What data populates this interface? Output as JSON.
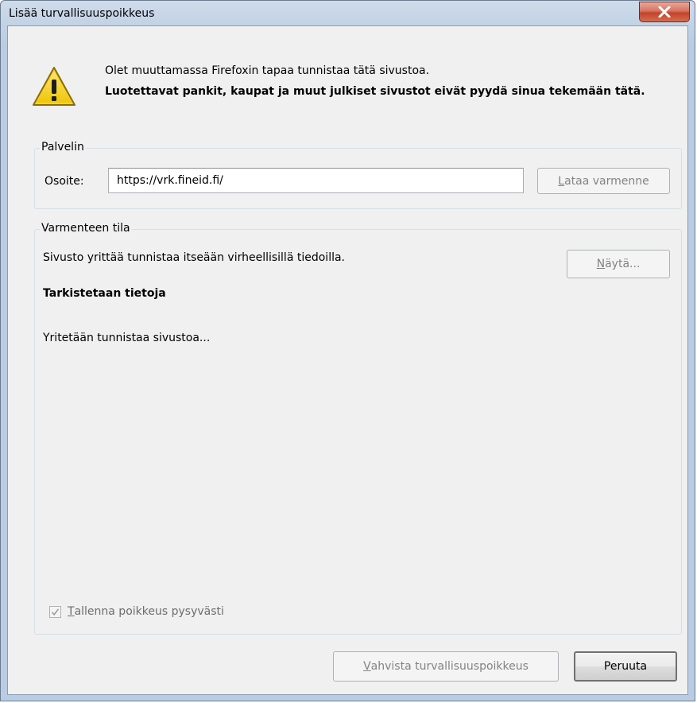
{
  "window": {
    "title": "Lisää turvallisuuspoikkeus"
  },
  "warning": {
    "icon": "warning-triangle-icon",
    "line1": "Olet muuttamassa Firefoxin tapaa tunnistaa tätä sivustoa.",
    "line2": "Luotettavat pankit, kaupat ja muut julkiset sivustot eivät pyydä sinua tekemään tätä."
  },
  "server": {
    "legend": "Palvelin",
    "address_label": "Osoite:",
    "address_value": "https://vrk.fineid.fi/",
    "load_cert_mnemonic": "L",
    "load_cert_rest": "ataa varmenne"
  },
  "status": {
    "legend": "Varmenteen tila",
    "text": "Sivusto yrittää tunnistaa itseään virheellisillä tiedoilla.",
    "show_mnemonic": "N",
    "show_rest": "äytä...",
    "heading": "Tarkistetaan tietoja",
    "identifying": "Yritetään tunnistaa sivustoa...",
    "save_mnemonic": "T",
    "save_rest": "allenna poikkeus pysyvästi",
    "save_checked": true
  },
  "buttons": {
    "confirm_mnemonic": "V",
    "confirm_rest": "ahvista turvallisuuspoikkeus",
    "cancel": "Peruuta"
  },
  "colors": {
    "client_bg": "#f0f0f0",
    "close_red": "#c2442c",
    "warning_yellow": "#f7d31a",
    "disabled_text": "#838383",
    "default_button_border": "#3c7fb1"
  }
}
